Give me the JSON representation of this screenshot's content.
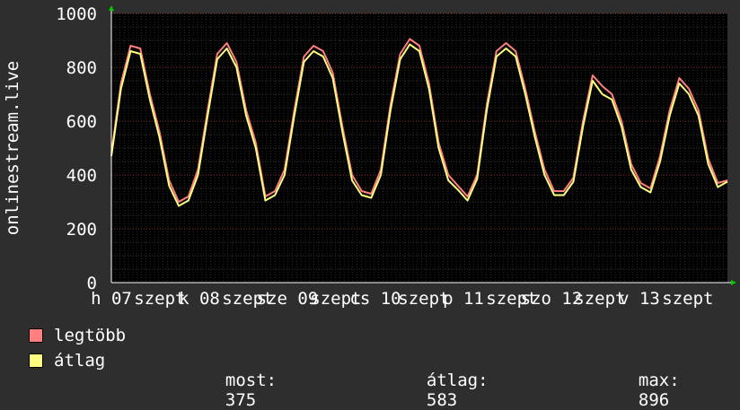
{
  "chart_data": {
    "type": "line",
    "ylabel": "onlinestream.live",
    "ylim": [
      0,
      1000
    ],
    "yticks": [
      0,
      200,
      400,
      600,
      800,
      1000
    ],
    "ytick_labels": [
      "0",
      "200",
      "400",
      "600",
      "800",
      "1000"
    ],
    "x_tick_labels": [
      "h 07",
      "szept",
      "k 08",
      "szept",
      "sze 09",
      "szept",
      "cs 10",
      "szept",
      "p 11",
      "szept",
      "szo 12",
      "szept",
      "v 13",
      "szept"
    ],
    "grid": true,
    "legend_placement": "bottom-left",
    "series": [
      {
        "name": "legtöbb",
        "color": "#ff7f7f",
        "values": [
          480,
          740,
          880,
          870,
          700,
          560,
          380,
          300,
          320,
          420,
          640,
          850,
          890,
          820,
          640,
          520,
          320,
          340,
          420,
          640,
          840,
          880,
          860,
          780,
          580,
          400,
          340,
          330,
          420,
          660,
          850,
          905,
          880,
          740,
          520,
          400,
          360,
          320,
          400,
          660,
          860,
          890,
          860,
          720,
          560,
          420,
          340,
          340,
          390,
          600,
          770,
          730,
          700,
          600,
          440,
          370,
          350,
          470,
          640,
          760,
          720,
          640,
          460,
          370,
          380
        ]
      },
      {
        "name": "átlag",
        "color": "#ffff80",
        "values": [
          470,
          720,
          860,
          850,
          680,
          540,
          360,
          285,
          305,
          400,
          620,
          830,
          870,
          800,
          620,
          500,
          305,
          325,
          400,
          620,
          820,
          860,
          840,
          760,
          560,
          380,
          325,
          315,
          400,
          640,
          830,
          885,
          860,
          720,
          500,
          380,
          345,
          305,
          385,
          640,
          840,
          870,
          840,
          700,
          540,
          400,
          325,
          325,
          375,
          580,
          750,
          700,
          680,
          580,
          420,
          355,
          335,
          450,
          620,
          740,
          700,
          620,
          440,
          355,
          375
        ]
      }
    ],
    "stats": {
      "most_label": "most:",
      "most": "375",
      "atlag_label": "átlag:",
      "atlag": "583",
      "max_label": "max:",
      "max": "896"
    }
  }
}
